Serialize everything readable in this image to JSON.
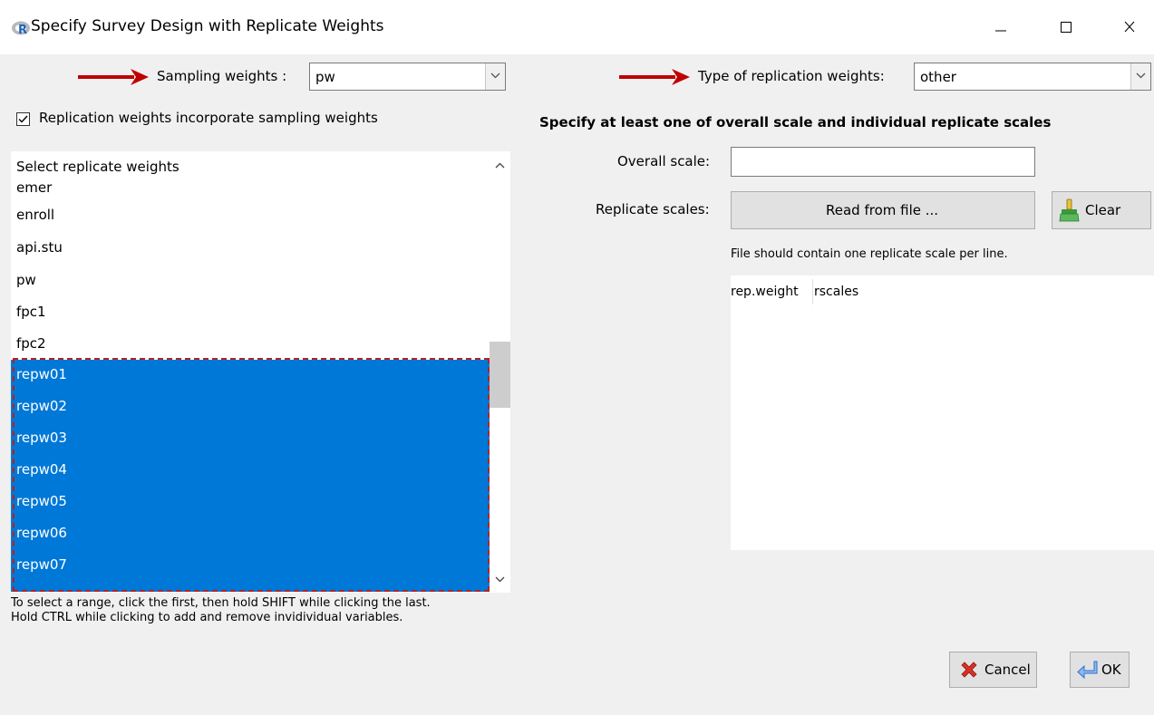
{
  "window": {
    "title": "Specify Survey Design with Replicate Weights",
    "controls": {
      "minimize": "minimize-icon",
      "maximize": "maximize-icon",
      "close": "close-icon"
    }
  },
  "sampling": {
    "label": "Sampling weights :",
    "value": "pw"
  },
  "replication_type": {
    "label": "Type of replication weights:",
    "value": "other"
  },
  "incorporate": {
    "label": "Replication weights incorporate sampling weights",
    "checked": true
  },
  "variables": {
    "header": "Select replicate weights",
    "items": [
      {
        "label": "emer",
        "selected": false
      },
      {
        "label": "enroll",
        "selected": false
      },
      {
        "label": "api.stu",
        "selected": false
      },
      {
        "label": "pw",
        "selected": false
      },
      {
        "label": "fpc1",
        "selected": false
      },
      {
        "label": "fpc2",
        "selected": false
      },
      {
        "label": "repw01",
        "selected": true
      },
      {
        "label": "repw02",
        "selected": true
      },
      {
        "label": "repw03",
        "selected": true
      },
      {
        "label": "repw04",
        "selected": true
      },
      {
        "label": "repw05",
        "selected": true
      },
      {
        "label": "repw06",
        "selected": true
      },
      {
        "label": "repw07",
        "selected": true
      }
    ],
    "hint_line1": "To select a range, click the first, then hold SHIFT while clicking the last.",
    "hint_line2": "Hold CTRL while clicking to add and remove invidividual variables."
  },
  "scales": {
    "heading": "Specify at least one of overall scale and individual replicate scales",
    "overall_label": "Overall scale:",
    "overall_value": "",
    "replicate_label": "Replicate scales:",
    "read_button": "Read from file ...",
    "clear_button": "Clear",
    "note": "File should contain one replicate scale per line.",
    "table_columns": [
      "rep.weight",
      "rscales"
    ]
  },
  "buttons": {
    "cancel": "Cancel",
    "ok": "OK"
  },
  "colors": {
    "selection": "#0078d7",
    "annotation_red": "#b22222",
    "cancel_x": "#d93025",
    "ok_blue": "#2d6fd1"
  }
}
